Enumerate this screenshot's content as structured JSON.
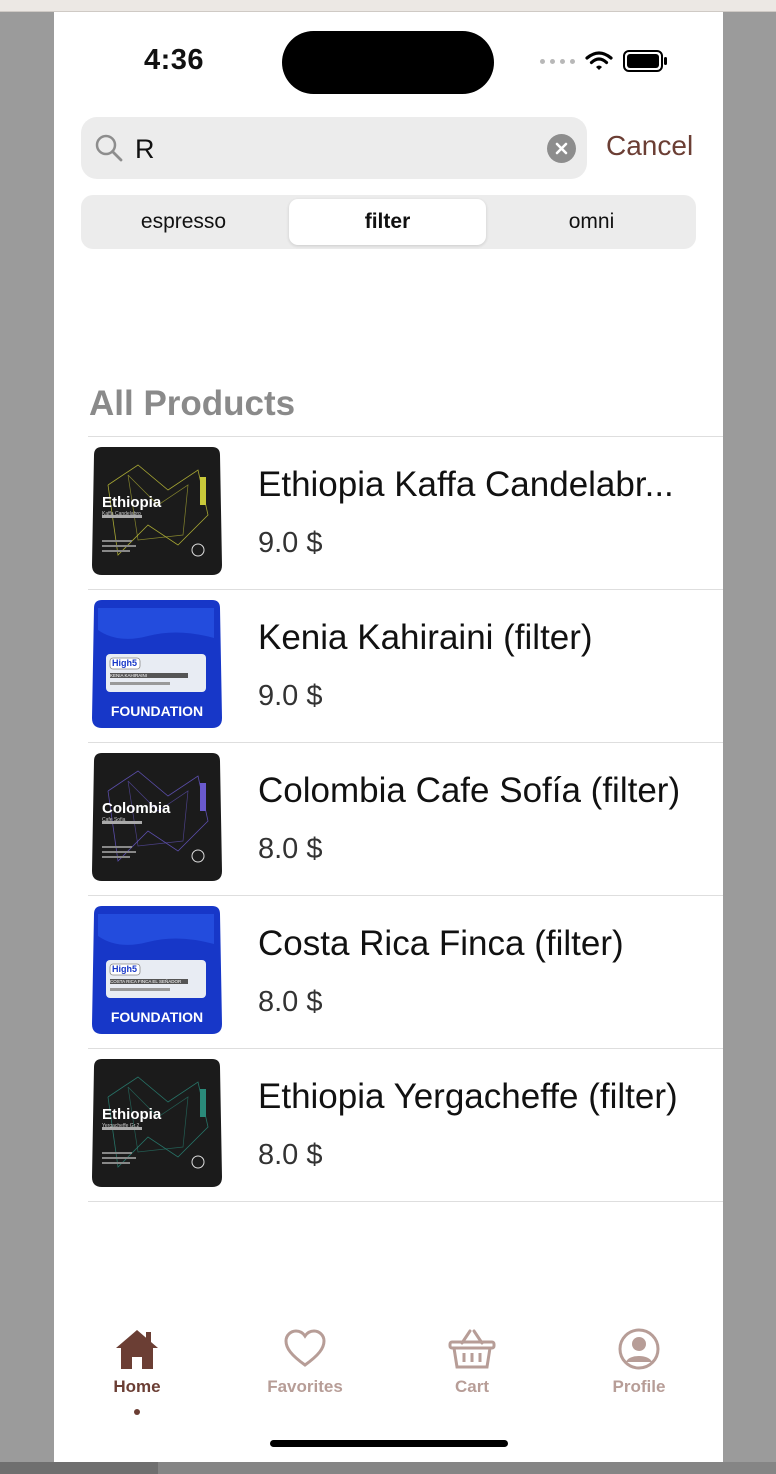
{
  "status_bar": {
    "time": "4:36"
  },
  "search": {
    "query": "R",
    "cancel_label": "Cancel"
  },
  "segments": [
    {
      "label": "espresso",
      "selected": false
    },
    {
      "label": "filter",
      "selected": true
    },
    {
      "label": "omni",
      "selected": false
    }
  ],
  "section_title": "All Products",
  "products": [
    {
      "name": "Ethiopia Kaffa Candelabr...",
      "price": "9.0 $",
      "bag_style": "black",
      "bag_text": "Ethiopia",
      "bag_subtext": "Kaffa Candelabro",
      "accent": "#c9c93a"
    },
    {
      "name": "Kenia Kahiraini (filter)",
      "price": "9.0 $",
      "bag_style": "blue",
      "bag_text": "High5",
      "bag_subtext": "KENIA KAHIRAINI",
      "bag_footer": "FOUNDATION",
      "accent": "#1230b8"
    },
    {
      "name": "Colombia Cafe Sofía (filter)",
      "price": "8.0 $",
      "bag_style": "black",
      "bag_text": "Colombia",
      "bag_subtext": "Cafe Sofia",
      "accent": "#6a5acd"
    },
    {
      "name": "Costa Rica Finca (filter)",
      "price": "8.0 $",
      "bag_style": "blue",
      "bag_text": "High5",
      "bag_subtext": "COSTA RICA FINCA EL SEÑADOR",
      "bag_footer": "FOUNDATION",
      "accent": "#1230b8"
    },
    {
      "name": "Ethiopia Yergacheffe (filter)",
      "price": "8.0 $",
      "bag_style": "black",
      "bag_text": "Ethiopia",
      "bag_subtext": "Yergacheffe Gr.2",
      "accent": "#2a8a7a"
    }
  ],
  "tabbar": [
    {
      "label": "Home",
      "icon": "home-icon",
      "active": true
    },
    {
      "label": "Favorites",
      "icon": "heart-icon",
      "active": false
    },
    {
      "label": "Cart",
      "icon": "basket-icon",
      "active": false
    },
    {
      "label": "Profile",
      "icon": "person-icon",
      "active": false
    }
  ],
  "colors": {
    "accent": "#6b3e34",
    "inactive_tab": "#b79d97",
    "section_title": "#8a8a8a"
  }
}
